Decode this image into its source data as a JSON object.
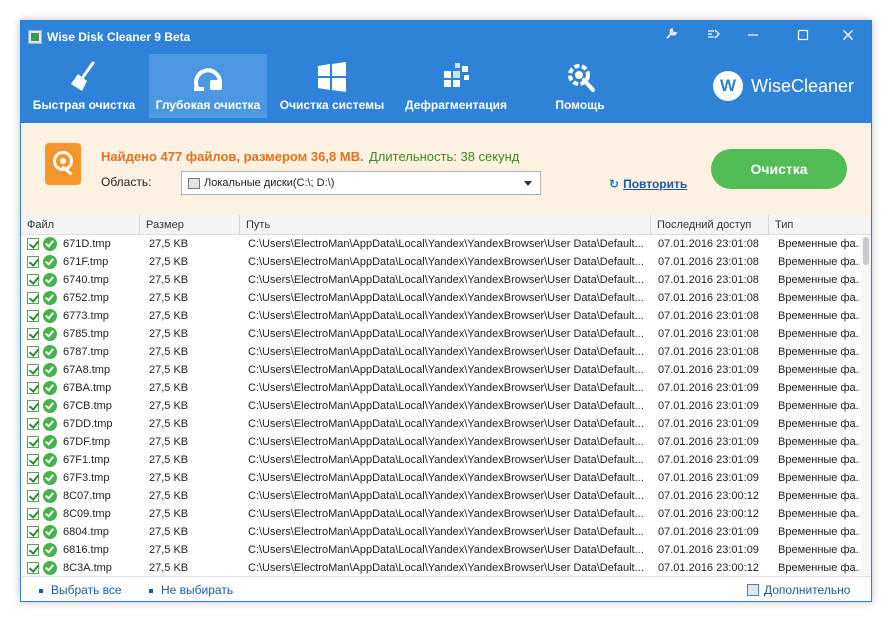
{
  "window": {
    "title": "Wise Disk Cleaner 9 Beta"
  },
  "toolbar": {
    "items": [
      {
        "label": "Быстрая очистка",
        "icon": "broom-icon"
      },
      {
        "label": "Глубокая очистка",
        "icon": "vacuum-icon"
      },
      {
        "label": "Очистка системы",
        "icon": "windows-icon"
      },
      {
        "label": "Дефрагментация",
        "icon": "defrag-icon"
      },
      {
        "label": "Помощь",
        "icon": "gear-wrench-icon"
      }
    ],
    "active_index": 1
  },
  "brand": {
    "letter": "W",
    "name": "WiseCleaner"
  },
  "summary": {
    "found": "Найдено 477 файлов, размером 36,8 МВ.",
    "duration": "Длительность: 38 секунд",
    "area_label": "Область:",
    "area_value": "Локальные диски(C:\\; D:\\)",
    "repeat_label": "Повторить",
    "clean_button": "Очистка"
  },
  "table": {
    "columns": [
      "Файл",
      "Размер",
      "Путь",
      "Последний доступ",
      "Тип"
    ],
    "rows": [
      {
        "file": "671D.tmp",
        "size": "27,5 KB",
        "path": "C:\\Users\\ElectroMan\\AppData\\Local\\Yandex\\YandexBrowser\\User Data\\Default...",
        "date": "07.01.2016 23:01:08",
        "type": "Временные фа..."
      },
      {
        "file": "671F.tmp",
        "size": "27,5 KB",
        "path": "C:\\Users\\ElectroMan\\AppData\\Local\\Yandex\\YandexBrowser\\User Data\\Default...",
        "date": "07.01.2016 23:01:08",
        "type": "Временные фа..."
      },
      {
        "file": "6740.tmp",
        "size": "27,5 KB",
        "path": "C:\\Users\\ElectroMan\\AppData\\Local\\Yandex\\YandexBrowser\\User Data\\Default...",
        "date": "07.01.2016 23:01:08",
        "type": "Временные фа..."
      },
      {
        "file": "6752.tmp",
        "size": "27,5 KB",
        "path": "C:\\Users\\ElectroMan\\AppData\\Local\\Yandex\\YandexBrowser\\User Data\\Default...",
        "date": "07.01.2016 23:01:08",
        "type": "Временные фа..."
      },
      {
        "file": "6773.tmp",
        "size": "27,5 KB",
        "path": "C:\\Users\\ElectroMan\\AppData\\Local\\Yandex\\YandexBrowser\\User Data\\Default...",
        "date": "07.01.2016 23:01:08",
        "type": "Временные фа..."
      },
      {
        "file": "6785.tmp",
        "size": "27,5 KB",
        "path": "C:\\Users\\ElectroMan\\AppData\\Local\\Yandex\\YandexBrowser\\User Data\\Default...",
        "date": "07.01.2016 23:01:08",
        "type": "Временные фа..."
      },
      {
        "file": "6787.tmp",
        "size": "27,5 KB",
        "path": "C:\\Users\\ElectroMan\\AppData\\Local\\Yandex\\YandexBrowser\\User Data\\Default...",
        "date": "07.01.2016 23:01:08",
        "type": "Временные фа..."
      },
      {
        "file": "67A8.tmp",
        "size": "27,5 KB",
        "path": "C:\\Users\\ElectroMan\\AppData\\Local\\Yandex\\YandexBrowser\\User Data\\Default...",
        "date": "07.01.2016 23:01:09",
        "type": "Временные фа..."
      },
      {
        "file": "67BA.tmp",
        "size": "27,5 KB",
        "path": "C:\\Users\\ElectroMan\\AppData\\Local\\Yandex\\YandexBrowser\\User Data\\Default...",
        "date": "07.01.2016 23:01:09",
        "type": "Временные фа..."
      },
      {
        "file": "67CB.tmp",
        "size": "27,5 KB",
        "path": "C:\\Users\\ElectroMan\\AppData\\Local\\Yandex\\YandexBrowser\\User Data\\Default...",
        "date": "07.01.2016 23:01:09",
        "type": "Временные фа..."
      },
      {
        "file": "67DD.tmp",
        "size": "27,5 KB",
        "path": "C:\\Users\\ElectroMan\\AppData\\Local\\Yandex\\YandexBrowser\\User Data\\Default...",
        "date": "07.01.2016 23:01:09",
        "type": "Временные фа..."
      },
      {
        "file": "67DF.tmp",
        "size": "27,5 KB",
        "path": "C:\\Users\\ElectroMan\\AppData\\Local\\Yandex\\YandexBrowser\\User Data\\Default...",
        "date": "07.01.2016 23:01:09",
        "type": "Временные фа..."
      },
      {
        "file": "67F1.tmp",
        "size": "27,5 KB",
        "path": "C:\\Users\\ElectroMan\\AppData\\Local\\Yandex\\YandexBrowser\\User Data\\Default...",
        "date": "07.01.2016 23:01:09",
        "type": "Временные фа..."
      },
      {
        "file": "67F3.tmp",
        "size": "27,5 KB",
        "path": "C:\\Users\\ElectroMan\\AppData\\Local\\Yandex\\YandexBrowser\\User Data\\Default...",
        "date": "07.01.2016 23:01:09",
        "type": "Временные фа..."
      },
      {
        "file": "8C07.tmp",
        "size": "27,5 KB",
        "path": "C:\\Users\\ElectroMan\\AppData\\Local\\Yandex\\YandexBrowser\\User Data\\Default...",
        "date": "07.01.2016 23:00:12",
        "type": "Временные фа..."
      },
      {
        "file": "8C09.tmp",
        "size": "27,5 KB",
        "path": "C:\\Users\\ElectroMan\\AppData\\Local\\Yandex\\YandexBrowser\\User Data\\Default...",
        "date": "07.01.2016 23:00:12",
        "type": "Временные фа..."
      },
      {
        "file": "6804.tmp",
        "size": "27,5 KB",
        "path": "C:\\Users\\ElectroMan\\AppData\\Local\\Yandex\\YandexBrowser\\User Data\\Default...",
        "date": "07.01.2016 23:01:09",
        "type": "Временные фа..."
      },
      {
        "file": "6816.tmp",
        "size": "27,5 KB",
        "path": "C:\\Users\\ElectroMan\\AppData\\Local\\Yandex\\YandexBrowser\\User Data\\Default...",
        "date": "07.01.2016 23:01:09",
        "type": "Временные фа..."
      },
      {
        "file": "8C3A.tmp",
        "size": "27,5 KB",
        "path": "C:\\Users\\ElectroMan\\AppData\\Local\\Yandex\\YandexBrowser\\User Data\\Default...",
        "date": "07.01.2016 23:00:12",
        "type": "Временные фа..."
      }
    ]
  },
  "footer": {
    "select_all": "Выбрать все",
    "select_none": "Не выбирать",
    "more": "Дополнительно"
  },
  "colors": {
    "header_bg": "#2e82d8",
    "active_tab": "#4b97e0",
    "summary_bg": "#fdf1e1",
    "found_text": "#e8701a",
    "duration_text": "#3a8a1f",
    "clean_button": "#52bd57",
    "link": "#1c5aa8"
  }
}
